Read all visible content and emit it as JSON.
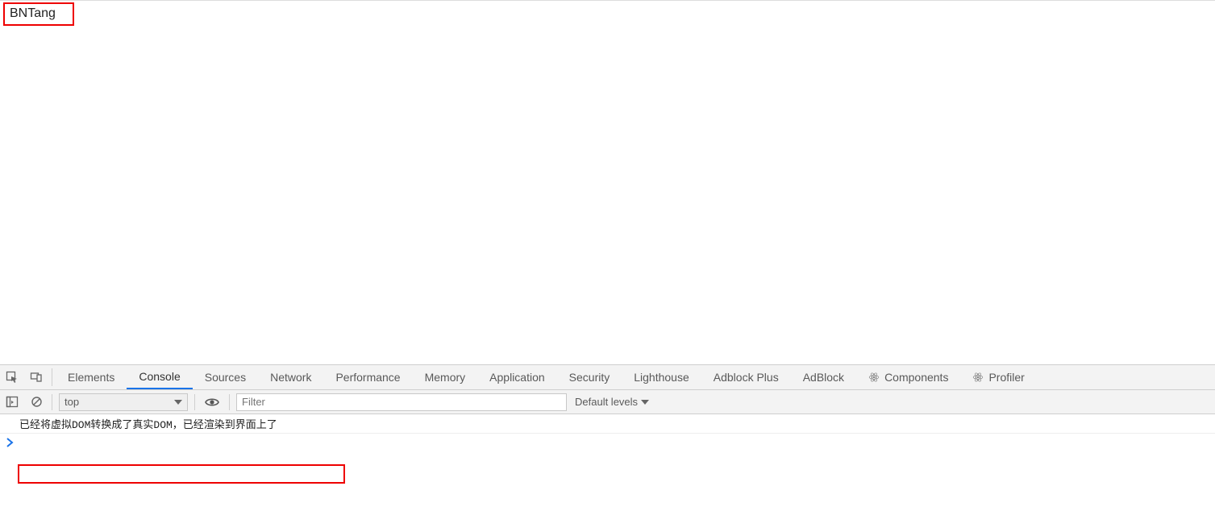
{
  "page": {
    "content_text": "BNTang"
  },
  "tabs": {
    "elements": "Elements",
    "console": "Console",
    "sources": "Sources",
    "network": "Network",
    "performance": "Performance",
    "memory": "Memory",
    "application": "Application",
    "security": "Security",
    "lighthouse": "Lighthouse",
    "adblockplus": "Adblock Plus",
    "adblock": "AdBlock",
    "components": "Components",
    "profiler": "Profiler"
  },
  "toolbar": {
    "context": "top",
    "filter_placeholder": "Filter",
    "levels": "Default levels"
  },
  "console": {
    "log1": "已经将虚拟DOM转换成了真实DOM，已经渲染到界面上了",
    "prompt": "❯"
  }
}
